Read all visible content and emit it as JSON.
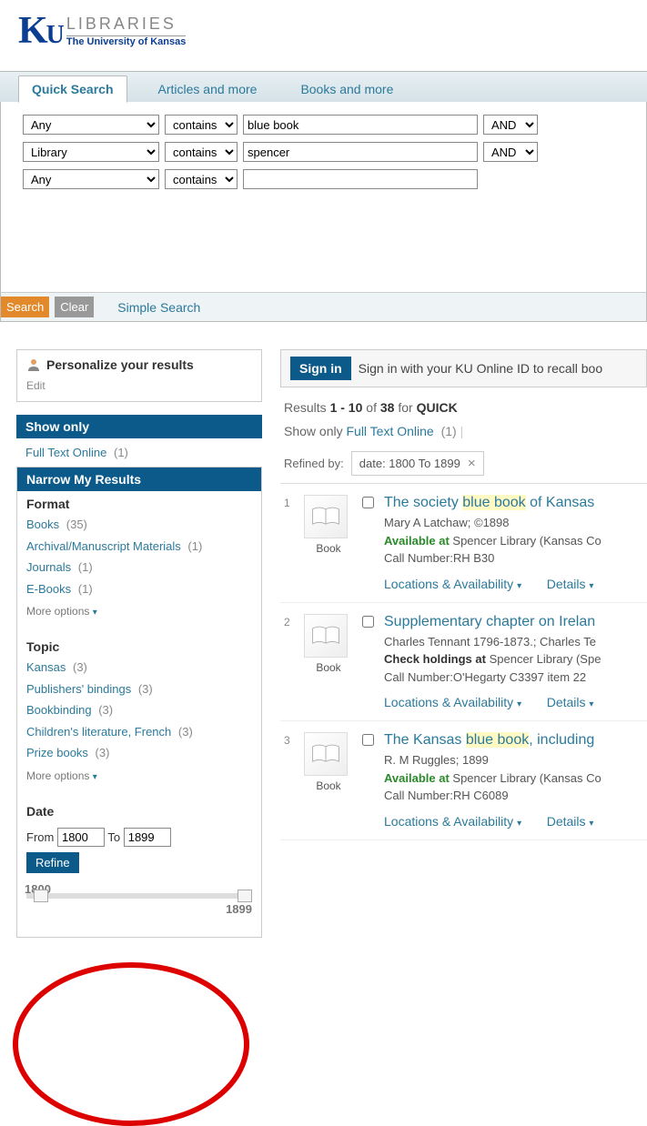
{
  "logo": {
    "ku": "KU",
    "libraries": "LIBRARIES",
    "subtitle": "The University of Kansas"
  },
  "tabs": [
    {
      "label": "Quick Search",
      "active": true
    },
    {
      "label": "Articles and more",
      "active": false
    },
    {
      "label": "Books and more",
      "active": false
    }
  ],
  "search_rows": [
    {
      "field": "Any",
      "match": "contains",
      "term": "blue book",
      "op": "AND"
    },
    {
      "field": "Library",
      "match": "contains",
      "term": "spencer",
      "op": "AND"
    },
    {
      "field": "Any",
      "match": "contains",
      "term": "",
      "op": null
    }
  ],
  "buttons": {
    "search": "Search",
    "clear": "Clear",
    "simple": "Simple Search"
  },
  "sidebar": {
    "personalize": "Personalize your results",
    "edit": "Edit",
    "show_only_header": "Show only",
    "show_only_items": [
      {
        "label": "Full Text Online",
        "count": "(1)"
      }
    ],
    "narrow_header": "Narrow My Results",
    "format_title": "Format",
    "format_items": [
      {
        "label": "Books",
        "count": "(35)"
      },
      {
        "label": "Archival/Manuscript Materials",
        "count": "(1)"
      },
      {
        "label": "Journals",
        "count": "(1)"
      },
      {
        "label": "E-Books",
        "count": "(1)"
      }
    ],
    "more_options": "More options",
    "topic_title": "Topic",
    "topic_items": [
      {
        "label": "Kansas",
        "count": "(3)"
      },
      {
        "label": "Publishers' bindings",
        "count": "(3)"
      },
      {
        "label": "Bookbinding",
        "count": "(3)"
      },
      {
        "label": "Children's literature, French",
        "count": "(3)"
      },
      {
        "label": "Prize books",
        "count": "(3)"
      }
    ],
    "date_title": "Date",
    "date_from_label": "From",
    "date_to_label": "To",
    "date_from": "1800",
    "date_to": "1899",
    "refine": "Refine",
    "slider_min": "1800",
    "slider_max": "1899"
  },
  "signin": {
    "button": "Sign in",
    "text": "Sign in with your KU Online ID to recall boo"
  },
  "results_meta": {
    "prefix": "Results ",
    "range": "1 - 10",
    "of": " of ",
    "total": "38",
    "for": "  for ",
    "query": "QUICK"
  },
  "show_only_inline": {
    "label": "Show only  ",
    "link": "Full Text Online",
    "count": "(1)"
  },
  "refined": {
    "label": "Refined by:",
    "tag": "date: 1800 To 1899"
  },
  "results": [
    {
      "num": "1",
      "type": "Book",
      "title_pre": "The society ",
      "title_hl": "blue book",
      "title_post": " of Kansas ",
      "author": "Mary A Latchaw; ©1898",
      "avail_label": "Available at",
      "avail_loc": "  Spencer Library (Kansas Co",
      "call": "Call Number:RH B30",
      "loc_link": "Locations & Availability",
      "det_link": "Details"
    },
    {
      "num": "2",
      "type": "Book",
      "title_pre": "Supplementary chapter on Irelan",
      "title_hl": "",
      "title_post": "",
      "author": "Charles Tennant 1796-1873.; Charles Te",
      "check_label": "Check holdings at",
      "check_loc": "  Spencer Library (Spe",
      "call": "Call Number:O'Hegarty C3397 item 22",
      "loc_link": "Locations & Availability",
      "det_link": "Details"
    },
    {
      "num": "3",
      "type": "Book",
      "title_pre": "The Kansas ",
      "title_hl": "blue book",
      "title_post": ", including ",
      "author": "R. M Ruggles; 1899",
      "avail_label": "Available at",
      "avail_loc": "  Spencer Library (Kansas Co",
      "call": "Call Number:RH C6089",
      "loc_link": "Locations & Availability",
      "det_link": "Details"
    }
  ]
}
